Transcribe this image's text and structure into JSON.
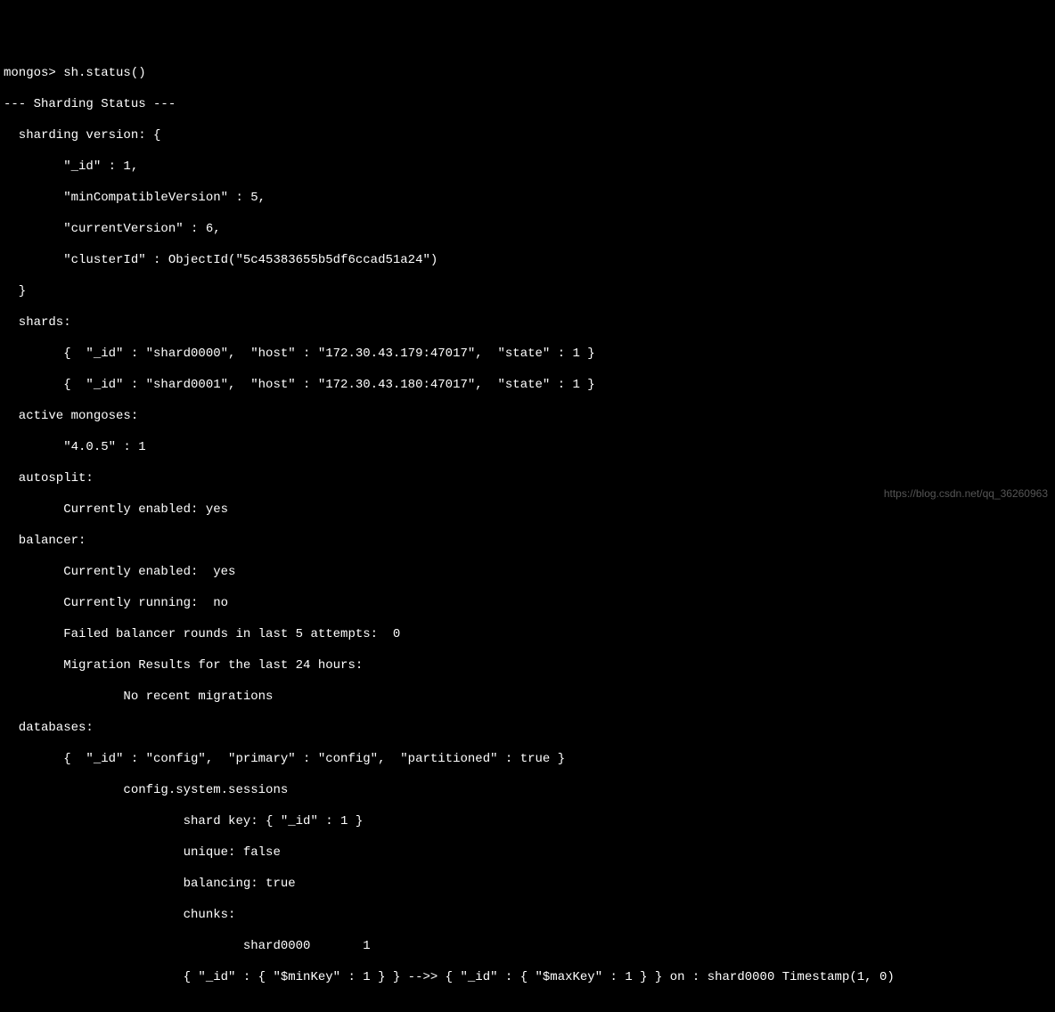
{
  "prompt": {
    "label": "mongos> ",
    "command": "sh.status()"
  },
  "header": "--- Sharding Status ---",
  "shardingVersion": {
    "label": "  sharding version: {",
    "id_line": "        \"_id\" : 1,",
    "minCompat_line": "        \"minCompatibleVersion\" : 5,",
    "currentVersion_line": "        \"currentVersion\" : 6,",
    "clusterId_line": "        \"clusterId\" : ObjectId(\"5c45383655b5df6ccad51a24\")",
    "close": "  }"
  },
  "shards": {
    "label": "  shards:",
    "shard0": "        {  \"_id\" : \"shard0000\",  \"host\" : \"172.30.43.179:47017\",  \"state\" : 1 }",
    "shard1": "        {  \"_id\" : \"shard0001\",  \"host\" : \"172.30.43.180:47017\",  \"state\" : 1 }"
  },
  "activeMongoses": {
    "label": "  active mongoses:",
    "version": "        \"4.0.5\" : 1"
  },
  "autosplit": {
    "label": "  autosplit:",
    "enabled": "        Currently enabled: yes"
  },
  "balancer": {
    "label": "  balancer:",
    "enabled": "        Currently enabled:  yes",
    "running": "        Currently running:  no",
    "failed": "        Failed balancer rounds in last 5 attempts:  0",
    "migration": "        Migration Results for the last 24 hours:",
    "noMigrations": "                No recent migrations"
  },
  "databases": {
    "label": "  databases:",
    "config": "        {  \"_id\" : \"config\",  \"primary\" : \"config\",  \"partitioned\" : true }",
    "sessions": "                config.system.sessions",
    "shardKey": "                        shard key: { \"_id\" : 1 }",
    "unique": "                        unique: false",
    "balancing": "                        balancing: true",
    "chunks": "                        chunks:",
    "shard0000": "                                shard0000       1",
    "range": "                        { \"_id\" : { \"$minKey\" : 1 } } -->> { \"_id\" : { \"$maxKey\" : 1 } } on : shard0000 Timestamp(1, 0)"
  },
  "watermark": "https://blog.csdn.net/qq_36260963"
}
